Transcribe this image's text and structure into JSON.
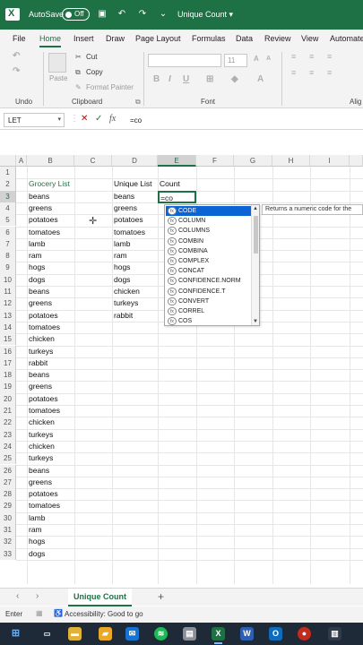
{
  "titlebar": {
    "autosave_label": "AutoSave",
    "toggle_state": "Off",
    "doc_title": "Unique Count ▾"
  },
  "tabs": [
    "File",
    "Home",
    "Insert",
    "Draw",
    "Page Layout",
    "Formulas",
    "Data",
    "Review",
    "View",
    "Automate"
  ],
  "active_tab": "Home",
  "ribbon": {
    "cut": "Cut",
    "copy": "Copy",
    "format_painter": "Format Painter",
    "paste": "Paste",
    "font_size": "11",
    "groups": {
      "undo": "Undo",
      "clipboard": "Clipboard",
      "font": "Font",
      "alignment": "Alig"
    }
  },
  "formula_bar": {
    "name_box": "LET",
    "formula": "=co",
    "cancel": "✕",
    "enter": "✓",
    "fx": "fx"
  },
  "columns": [
    "A",
    "B",
    "C",
    "D",
    "E",
    "F",
    "G",
    "H",
    "I"
  ],
  "active_column": "E",
  "rows": [
    "1",
    "2",
    "3",
    "4",
    "5",
    "6",
    "7",
    "8",
    "9",
    "10",
    "11",
    "12",
    "13",
    "14",
    "15",
    "16",
    "17",
    "18",
    "19",
    "20",
    "21",
    "22",
    "23",
    "24",
    "25",
    "26",
    "27",
    "28",
    "29",
    "30",
    "31",
    "32",
    "33"
  ],
  "cells": {
    "b2": "Grocery List",
    "b_list": [
      "beans",
      "greens",
      "potatoes",
      "tomatoes",
      "lamb",
      "ram",
      "hogs",
      "dogs",
      "beans",
      "greens",
      "potatoes",
      "tomatoes",
      "chicken",
      "turkeys",
      "rabbit",
      "beans",
      "greens",
      "potatoes",
      "tomatoes",
      "chicken",
      "turkeys",
      "chicken",
      "turkeys",
      "beans",
      "greens",
      "potatoes",
      "tomatoes",
      "lamb",
      "ram",
      "hogs",
      "dogs"
    ],
    "d2": "Unique List",
    "e2": "Count",
    "d_list": [
      "beans",
      "greens",
      "potatoes",
      "tomatoes",
      "lamb",
      "ram",
      "hogs",
      "dogs",
      "chicken",
      "turkeys",
      "rabbit"
    ],
    "e3": "=co"
  },
  "autocomplete": {
    "items": [
      "CODE",
      "COLUMN",
      "COLUMNS",
      "COMBIN",
      "COMBINA",
      "COMPLEX",
      "CONCAT",
      "CONFIDENCE.NORM",
      "CONFIDENCE.T",
      "CONVERT",
      "CORREL",
      "COS"
    ],
    "selected": "CODE",
    "tooltip": "Returns a numeric code for the"
  },
  "sheet_tabs": {
    "active": "Unique Count",
    "add": "+"
  },
  "status": {
    "mode": "Enter",
    "accessibility": "Accessibility: Good to go"
  },
  "colors": {
    "brand": "#1e7145",
    "selection": "#0a64d6"
  }
}
